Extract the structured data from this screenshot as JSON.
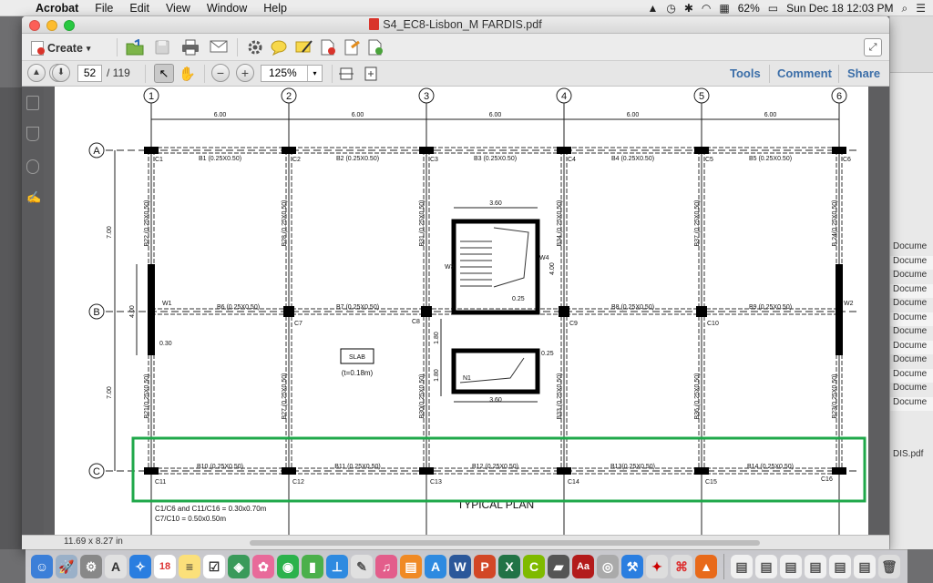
{
  "menubar": {
    "apple": "",
    "items": [
      "Acrobat",
      "File",
      "Edit",
      "View",
      "Window",
      "Help"
    ],
    "battery": "62%",
    "clock": "Sun Dec 18  12:03 PM"
  },
  "window": {
    "title": "S4_EC8-Lisbon_M FARDIS.pdf"
  },
  "toolbar": {
    "create_label": "Create",
    "create_arrow": "▾",
    "page_current": "52",
    "page_total": "/ 119",
    "zoom": "125%",
    "zoom_arrow": "▾",
    "tools_label": "Tools",
    "comment_label": "Comment",
    "share_label": "Share"
  },
  "sidebar_right": {
    "doc_items": [
      "Docume",
      "Docume",
      "Docume",
      "Docume",
      "Docume",
      "Docume",
      "Docume",
      "Docume",
      "Docume",
      "Docume",
      "Docume",
      "Docume"
    ],
    "file_label": "DIS.pdf"
  },
  "status": {
    "page_size": "11.69 x 8.27 in"
  },
  "drawing": {
    "grid_numbers": [
      "1",
      "2",
      "3",
      "4",
      "5",
      "6"
    ],
    "grid_letters": [
      "A",
      "B",
      "C"
    ],
    "spans": [
      "6.00",
      "6.00",
      "6.00",
      "6.00",
      "6.00"
    ],
    "bays": [
      "7.00",
      "7.00"
    ],
    "columns_top": [
      "C1",
      "C2",
      "C3",
      "C4",
      "C5",
      "C6"
    ],
    "columns_mid": [
      "C7",
      "C8",
      "C9",
      "C10"
    ],
    "columns_bottom": [
      "C11",
      "C12",
      "C13",
      "C14",
      "C15",
      "C16"
    ],
    "beams_top": [
      "B1  (0.25X0.50)",
      "B2  (0.25X0.50)",
      "B3  (0.25X0.50)",
      "B4  (0.25X0.50)",
      "B5  (0.25X0.50)"
    ],
    "beams_mid": [
      "B6  (0.25X0.50)",
      "B7  (0.25X0.50)",
      "B8  (0.25X0.50)",
      "B9  (0.25X0.50)"
    ],
    "beams_bottom": [
      "B10  (0.25X0.50)",
      "B11  (0.25X0.50)",
      "B12  (0.25X0.50)",
      "B13(0.25X0.50)",
      "B14  (0.25X0.50)"
    ],
    "beams_vert_upper": [
      "B22  (0.25X0.50)",
      "B28  (0.25X0.50)",
      "B31  (0.25X0.50)",
      "B34  (0.25X0.50)",
      "B37  (0.25X0.50)",
      "B 24(0.25X0.50)"
    ],
    "beams_vert_lower": [
      "B21(0.25X0.50)",
      "B27  (0.25X0.50)",
      "B30(0.25X0.50)",
      "B33  (0.25X0.50)",
      "B36  (0.25X0.50)",
      "B23(0.25X0.50)"
    ],
    "walls": [
      "W1",
      "W2",
      "W3",
      "W4",
      "N1"
    ],
    "stair_dims": [
      "3.60",
      "3.60",
      "4.00",
      "0.25",
      "0.25",
      "1.80",
      "1.80"
    ],
    "wall_dims": [
      "4.00",
      "0.30"
    ],
    "slab_label": "SLAB",
    "slab_thickness": "(t=0.18m)",
    "notes": [
      "C1/C6  and  C11/C16  =  0.30x0.70m",
      "C7/C10  =  0.50x0.50m"
    ],
    "plan_title": "TYPICAL PLAN",
    "highlight_color": "#1fa84a"
  }
}
